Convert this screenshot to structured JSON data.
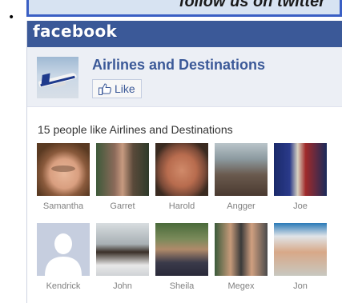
{
  "banner": {
    "text": "follow us on twitter"
  },
  "facebook": {
    "logo": "facebook",
    "page_name": "Airlines and Destinations",
    "like_label": "Like",
    "fans_text": "15 people like Airlines and Destinations",
    "fans": [
      {
        "name": "Samantha"
      },
      {
        "name": "Garret"
      },
      {
        "name": "Harold"
      },
      {
        "name": "Angger"
      },
      {
        "name": "Joe"
      },
      {
        "name": "Kendrick"
      },
      {
        "name": "John"
      },
      {
        "name": "Sheila"
      },
      {
        "name": "Megex"
      },
      {
        "name": "Jon"
      }
    ]
  },
  "colors": {
    "facebook_blue": "#3b5998",
    "header_area": "#eceff5",
    "banner_border": "#3a5fc4"
  }
}
